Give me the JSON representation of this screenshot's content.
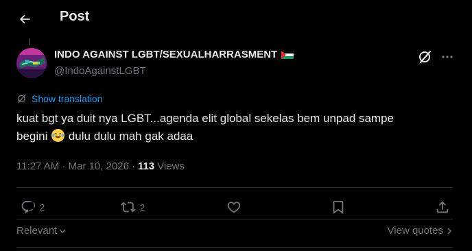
{
  "header": {
    "title": "Post"
  },
  "author": {
    "display_name": "INDO AGAINST LGBT/SEXUALHARRASMENT",
    "handle": "@IndoAgainstLGBT"
  },
  "post": {
    "translate_label": "Show translation",
    "text_line1": "kuat bgt ya duit nya LGBT...agenda elit global sekelas bem unpad sampe",
    "text_line2_before": "begini",
    "text_line2_after": "dulu dulu mah gak adaa",
    "timestamp": "11:27 AM · Mar 10, 2026",
    "separator": "·",
    "views_count": "113",
    "views_label": "Views"
  },
  "actions": {
    "replies": "2",
    "reposts": "2",
    "likes": "",
    "bookmarks": ""
  },
  "footer": {
    "sort_label": "Relevant",
    "quotes_label": "View quotes"
  },
  "colors": {
    "background": "#000000",
    "text": "#e7e9ea",
    "muted": "#71767b",
    "accent": "#1d9bf0",
    "divider": "#2f3336"
  }
}
